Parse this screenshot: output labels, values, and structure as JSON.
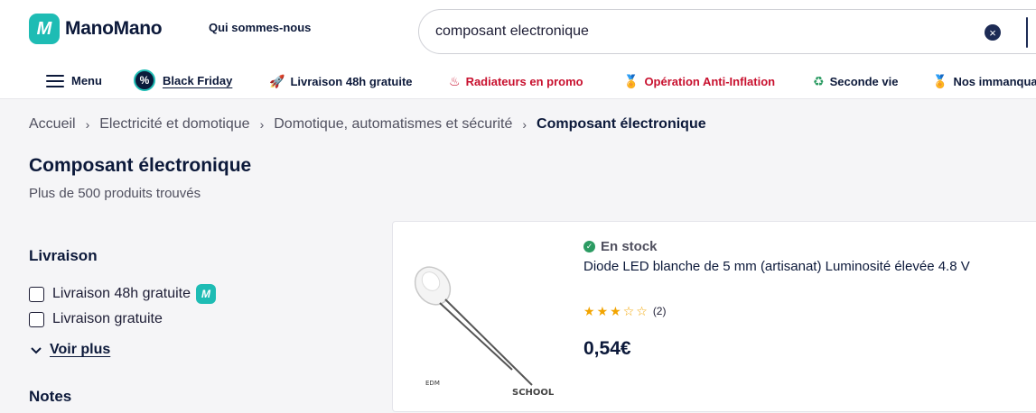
{
  "header": {
    "logo_text": "ManoMano",
    "logo_mark": "M",
    "about_link": "Qui sommes-nous",
    "search": {
      "value": "composant electronique",
      "clear_icon": "×"
    }
  },
  "nav": {
    "menu_label": "Menu",
    "black_friday": {
      "icon": "%",
      "label": "Black Friday"
    },
    "items": [
      {
        "icon": "🚀",
        "label": "Livraison 48h gratuite",
        "color": "#0c193a"
      },
      {
        "icon": "♨",
        "label": "Radiateurs en promo",
        "color": "#c8102e"
      },
      {
        "icon": "🏅",
        "label": "Opération Anti-Inflation",
        "color": "#c8102e"
      },
      {
        "icon": "♻",
        "label": "Seconde vie",
        "color": "#0c193a"
      },
      {
        "icon": "🏅",
        "label": "Nos immanquables",
        "color": "#0c193a"
      }
    ]
  },
  "breadcrumb": {
    "items": [
      "Accueil",
      "Electricité et domotique",
      "Domotique, automatismes et sécurité"
    ],
    "current": "Composant électronique",
    "separator": "›"
  },
  "page": {
    "title": "Composant électronique",
    "result_count": "Plus de 500 produits trouvés"
  },
  "filters": {
    "delivery": {
      "heading": "Livraison",
      "options": [
        "Livraison 48h gratuite",
        "Livraison gratuite"
      ],
      "badge": "M",
      "see_more": "Voir plus",
      "see_more_icon": "chevron-down-icon"
    },
    "notes_heading": "Notes"
  },
  "product": {
    "stock": "En stock",
    "stock_icon": "✓",
    "title": "Diode LED blanche de 5 mm (artisanat) Luminosité élevée 4.8 V",
    "rating": {
      "value": 3,
      "max": 5,
      "count": "(2)"
    },
    "price": "0,54€",
    "image_caption": "SCHOOL",
    "image_mark": "EDM"
  },
  "colors": {
    "brand": "#1ebcb4",
    "navy": "#0c193a",
    "promo_red": "#c8102e",
    "stock_green": "#2b9b62",
    "star": "#f2a400"
  }
}
